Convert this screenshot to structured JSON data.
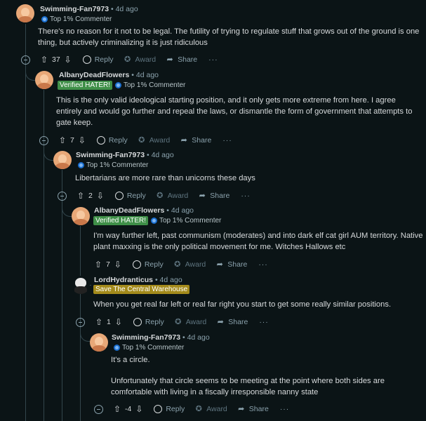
{
  "comments": [
    {
      "username": "Swimming-Fan7973",
      "time": "4d ago",
      "flair": "Top 1% Commenter",
      "body": [
        "There's no reason for it not to be legal. The futility of trying to regulate stuff that grows out of the ground is one thing, but actively criminalizing it is just ridiculous"
      ],
      "score": "37"
    },
    {
      "username": "AlbanyDeadFlowers",
      "time": "4d ago",
      "badge": "Verified HATER!",
      "flair": "Top 1% Commenter",
      "body": [
        "This is the only valid ideological starting position, and it only gets more extreme from here. I agree entirely and would go further and repeal the laws, or dismantle the form of government that attempts to gate keep."
      ],
      "score": "7"
    },
    {
      "username": "Swimming-Fan7973",
      "time": "4d ago",
      "flair": "Top 1% Commenter",
      "body": [
        "Libertarians are more rare than unicorns these days"
      ],
      "score": "2"
    },
    {
      "username": "AlbanyDeadFlowers",
      "time": "4d ago",
      "badge": "Verified HATER!",
      "flair": "Top 1% Commenter",
      "body": [
        "I'm way further left, past communism (moderates) and into dark elf cat girl AUM territory. Native plant maxxing is the only political movement for me. Witches Hallows etc"
      ],
      "score": "7"
    },
    {
      "username": "LordHydranticus",
      "time": "4d ago",
      "badge": "Save The Central Warehouse",
      "body": [
        "When you get real far left or real far right you start to get some really similar positions."
      ],
      "score": "1"
    },
    {
      "username": "Swimming-Fan7973",
      "time": "4d ago",
      "flair": "Top 1% Commenter",
      "body": [
        "It's a circle.",
        "Unfortunately that circle seems to be meeting at the point where both sides are comfortable with living in a fiscally irresponsible nanny state"
      ],
      "score": "-4"
    }
  ],
  "actions": {
    "reply": "Reply",
    "award": "Award",
    "share": "Share",
    "more": "···"
  },
  "separator": "•",
  "icons": {
    "upvote": "arrow-up-icon",
    "downvote": "arrow-down-icon",
    "reply": "comment-bubble-icon",
    "award": "award-icon",
    "share": "share-icon",
    "collapse": "collapse-icon",
    "flair": "flair-icon"
  },
  "colors": {
    "background": "#0b1416",
    "text": "#d7dadc",
    "muted": "#8ba2ad",
    "badge_green": "#3f8f48",
    "badge_gold": "#a38a1b",
    "thread_line": "#33464c"
  }
}
